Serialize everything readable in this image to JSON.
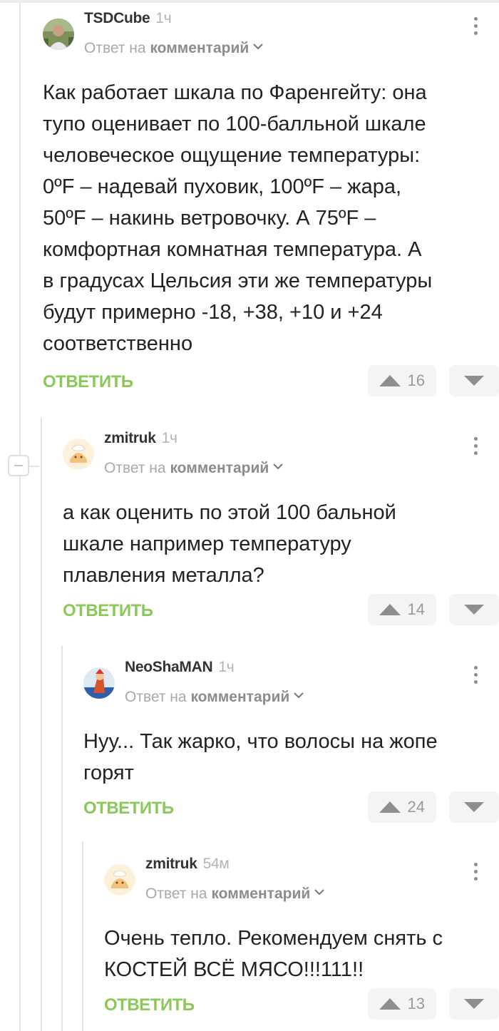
{
  "comments": [
    {
      "author": "TSDCube",
      "time": "1ч",
      "reply_prefix": "Ответ на",
      "reply_target": "комментарий",
      "lines": [
        "Как работает шкала по Фаренгейту: она",
        "тупо оценивает по 100-балльной шкале",
        "человеческое ощущение температуры:",
        "0ºF – надевай пуховик, 100ºF – жара,",
        "50ºF – накинь ветровочку. А 75ºF –",
        "комфортная комнатная температура. А",
        "в градусах Цельсия эти же температуры",
        "будут примерно -18, +38, +10 и +24",
        "соответственно"
      ],
      "answer_label": "ОТВЕТИТЬ",
      "rating": "16"
    },
    {
      "author": "zmitruk",
      "time": "1ч",
      "reply_prefix": "Ответ на",
      "reply_target": "комментарий",
      "lines": [
        "а как оценить по этой 100 бальной",
        "шкале например температуру",
        "плавления металла?"
      ],
      "answer_label": "ОТВЕТИТЬ",
      "rating": "14"
    },
    {
      "author": "NeoShaMAN",
      "time": "1ч",
      "reply_prefix": "Ответ на",
      "reply_target": "комментарий",
      "lines": [
        "Нуу... Так жарко, что волосы на жопе",
        "горят"
      ],
      "answer_label": "ОТВЕТИТЬ",
      "rating": "24"
    },
    {
      "author": "zmitruk",
      "time": "54м",
      "reply_prefix": "Ответ на",
      "reply_target": "комментарий",
      "lines": [
        "Очень тепло. Рекомендуем снять с",
        "КОСТЕЙ ВСЁ МЯСО!!!111!!"
      ],
      "answer_label": "ОТВЕТИТЬ",
      "rating": "13"
    }
  ],
  "icons": {
    "upvote": "arrow-up-icon",
    "downvote": "arrow-down-icon",
    "more": "more-vertical-icon",
    "chevron": "chevron-down-icon",
    "collapse": "minus-icon"
  },
  "colors": {
    "answer": "#8ac858",
    "meta": "#a9a9a9"
  }
}
